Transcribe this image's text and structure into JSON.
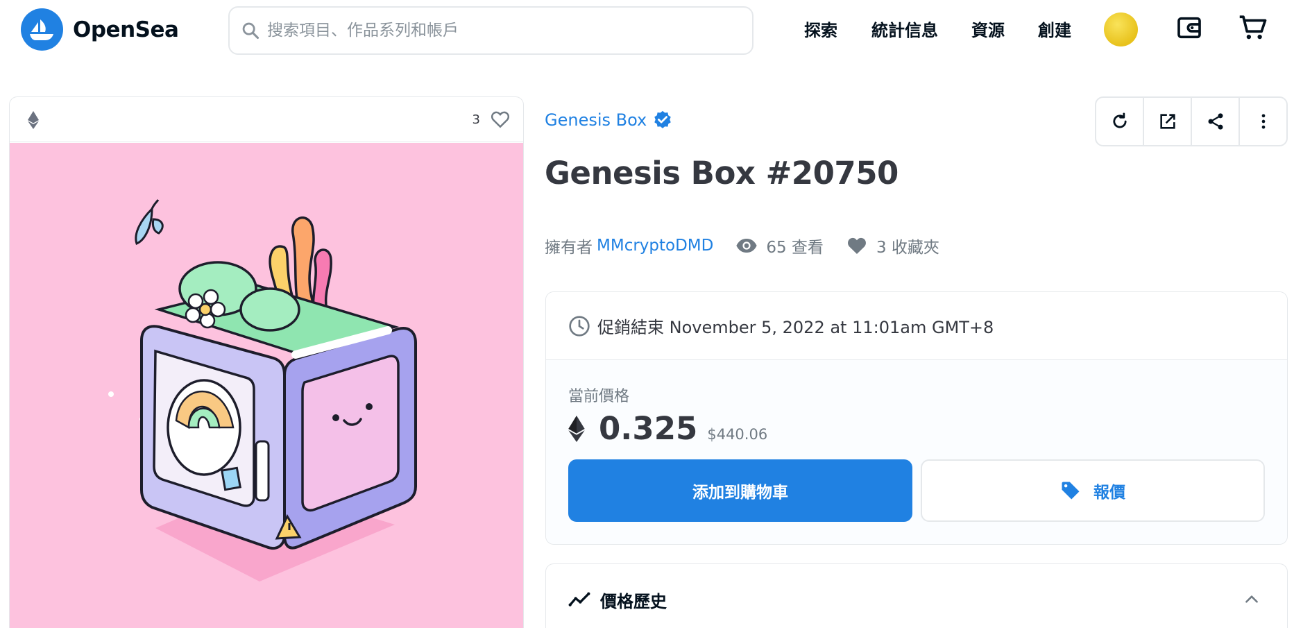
{
  "header": {
    "brand": "OpenSea",
    "search_placeholder": "搜索項目、作品系列和帳戶",
    "nav": [
      "探索",
      "統計信息",
      "資源",
      "創建"
    ]
  },
  "asset_card": {
    "favorite_count": "3"
  },
  "item": {
    "collection": "Genesis Box",
    "title": "Genesis Box #20750",
    "owner_label": "擁有者",
    "owner_name": "MMcryptoDMD",
    "views": "65 查看",
    "favorites": "3 收藏夾"
  },
  "sale": {
    "end_text": "促銷結束 November 5, 2022 at 11:01am GMT+8",
    "current_price_label": "當前價格",
    "price_eth": "0.325",
    "price_usd": "$440.06",
    "add_to_cart_label": "添加到購物車",
    "offer_label": "報價"
  },
  "price_history": {
    "title": "價格歷史"
  },
  "colors": {
    "brand_blue": "#2081e2",
    "art_background": "#fdc2de",
    "text_dark": "#353840",
    "text_muted": "#707a83"
  }
}
